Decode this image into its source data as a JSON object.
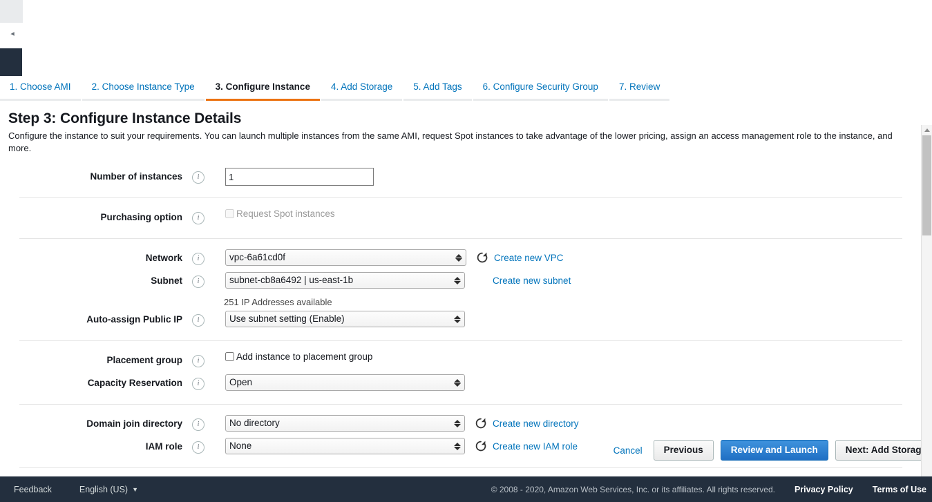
{
  "chrome": {
    "collapse_icon_label": "◂"
  },
  "wizard": {
    "tabs": [
      {
        "label": "1. Choose AMI",
        "active": false
      },
      {
        "label": "2. Choose Instance Type",
        "active": false
      },
      {
        "label": "3. Configure Instance",
        "active": true
      },
      {
        "label": "4. Add Storage",
        "active": false
      },
      {
        "label": "5. Add Tags",
        "active": false
      },
      {
        "label": "6. Configure Security Group",
        "active": false
      },
      {
        "label": "7. Review",
        "active": false
      }
    ],
    "active_tab_color": "#ec7211",
    "link_color": "#0073bb"
  },
  "page": {
    "title": "Step 3: Configure Instance Details",
    "description": "Configure the instance to suit your requirements. You can launch multiple instances from the same AMI, request Spot instances to take advantage of the lower pricing, assign an access management role to the instance, and more."
  },
  "form": {
    "number_of_instances": {
      "label": "Number of instances",
      "value": "1",
      "info_icon": "info-icon"
    },
    "purchasing_option": {
      "label": "Purchasing option",
      "checkbox_label": "Request Spot instances",
      "checked": false,
      "disabled": true
    },
    "network": {
      "label": "Network",
      "value": "vpc-6a61cd0f",
      "refresh_icon": "refresh-icon",
      "create_link": "Create new VPC"
    },
    "subnet": {
      "label": "Subnet",
      "value": "subnet-cb8a6492 | us-east-1b",
      "create_link": "Create new subnet",
      "helper_text": "251 IP Addresses available"
    },
    "auto_assign_public_ip": {
      "label": "Auto-assign Public IP",
      "value": "Use subnet setting (Enable)"
    },
    "placement_group": {
      "label": "Placement group",
      "checkbox_label": "Add instance to placement group",
      "checked": false
    },
    "capacity_reservation": {
      "label": "Capacity Reservation",
      "value": "Open"
    },
    "domain_join_directory": {
      "label": "Domain join directory",
      "value": "No directory",
      "refresh_icon": "refresh-icon",
      "create_link": "Create new directory"
    },
    "iam_role": {
      "label": "IAM role",
      "value": "None",
      "refresh_icon": "refresh-icon",
      "create_link": "Create new IAM role"
    }
  },
  "actions": {
    "cancel": "Cancel",
    "previous": "Previous",
    "review_and_launch": "Review and Launch",
    "next_add_storage": "Next: Add Storage",
    "primary_color": "#1f6fc4"
  },
  "footer": {
    "feedback": "Feedback",
    "language": "English (US)",
    "language_caret": "▼",
    "copyright": "© 2008 - 2020, Amazon Web Services, Inc. or its affiliates. All rights reserved.",
    "privacy_policy": "Privacy Policy",
    "terms_of_use": "Terms of Use"
  }
}
